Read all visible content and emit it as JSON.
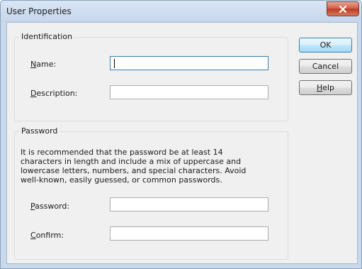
{
  "window": {
    "title": "User Properties"
  },
  "identification": {
    "title": "Identification",
    "name_label_mnemonic": "N",
    "name_label_rest": "ame:",
    "name_value": "",
    "description_label_mnemonic": "D",
    "description_label_rest": "escription:",
    "description_value": ""
  },
  "password": {
    "title": "Password",
    "recommendation": "It is recommended that the password be at least 14 characters in length and include a mix of uppercase and lowercase letters, numbers, and special characters. Avoid well-known, easily guessed, or common passwords.",
    "password_label_mnemonic": "P",
    "password_label_rest": "assword:",
    "password_value": "",
    "confirm_label_mnemonic": "C",
    "confirm_label_rest": "onfirm:",
    "confirm_value": ""
  },
  "buttons": {
    "ok": "OK",
    "cancel": "Cancel",
    "help_mnemonic": "H",
    "help_rest": "elp"
  },
  "icons": {
    "close": "close-icon"
  }
}
